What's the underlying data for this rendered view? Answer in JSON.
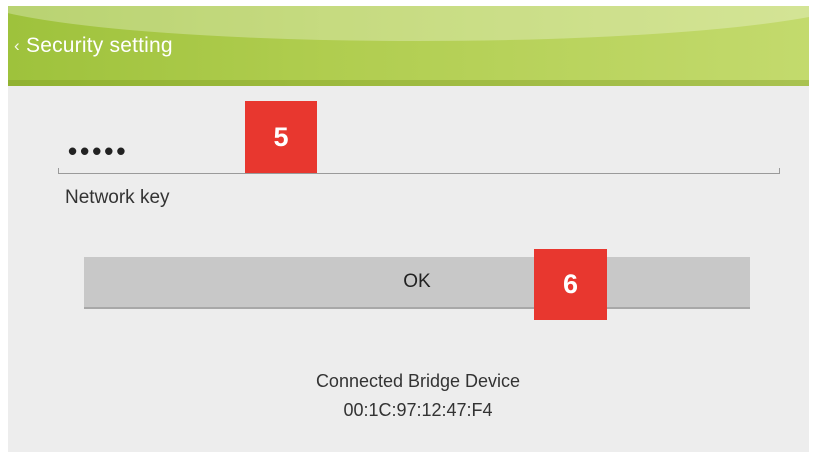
{
  "header": {
    "title": "Security setting",
    "back_icon": "chevron-left-icon"
  },
  "form": {
    "password_value": "•••••",
    "field_label": "Network key",
    "ok_label": "OK"
  },
  "status": {
    "title": "Connected Bridge Device",
    "mac": "00:1C:97:12:47:F4"
  },
  "callouts": {
    "five": "5",
    "six": "6",
    "color": "#e8372f"
  },
  "colors": {
    "header_green": "#9ec23c",
    "background": "#ededed",
    "button_gray": "#c8c8c8"
  }
}
